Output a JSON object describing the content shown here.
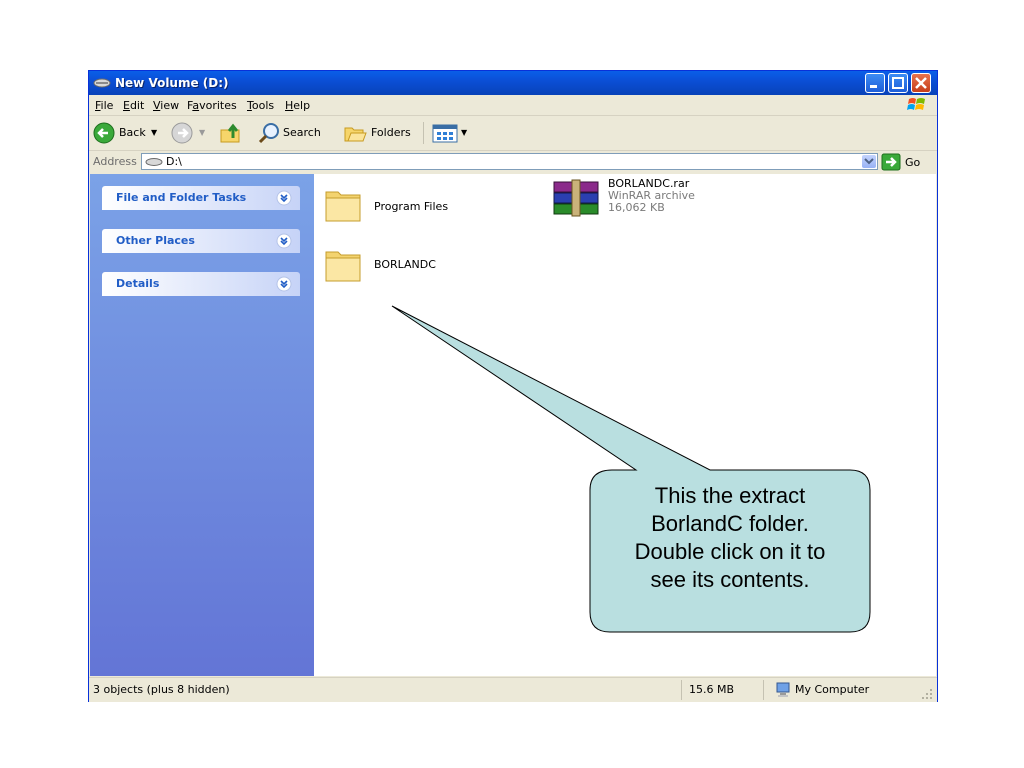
{
  "window": {
    "title": "New Volume (D:)"
  },
  "menu": {
    "items": [
      {
        "label": "File",
        "accel": "F"
      },
      {
        "label": "Edit",
        "accel": "E"
      },
      {
        "label": "View",
        "accel": "V"
      },
      {
        "label": "Favorites",
        "accel": "a"
      },
      {
        "label": "Tools",
        "accel": "T"
      },
      {
        "label": "Help",
        "accel": "H"
      }
    ]
  },
  "toolbar": {
    "back_label": "Back",
    "search_label": "Search",
    "folders_label": "Folders"
  },
  "address": {
    "label": "Address",
    "value": "D:\\",
    "go_label": "Go"
  },
  "sidebar": {
    "tasks": [
      {
        "title": "File and Folder Tasks"
      },
      {
        "title": "Other Places"
      },
      {
        "title": "Details"
      }
    ]
  },
  "files": [
    {
      "name": "Program Files",
      "type": "folder"
    },
    {
      "name": "BORLANDC",
      "type": "folder"
    },
    {
      "name": "BORLANDC.rar",
      "type": "archive",
      "subtitle": "WinRAR archive",
      "size": "16,062 KB"
    }
  ],
  "status": {
    "objects": "3 objects (plus 8 hidden)",
    "size": "15.6 MB",
    "location": "My Computer"
  },
  "callout": {
    "lines": [
      "This the extract",
      "BorlandC folder.",
      "Double click on it to",
      "see its contents."
    ]
  },
  "colors": {
    "titlebar": "#0b4fd6",
    "sidebar_top": "#7ba2e7",
    "sidebar_bottom": "#6375d6",
    "callout_fill": "#b9dfe0",
    "task_title": "#215dc6"
  }
}
